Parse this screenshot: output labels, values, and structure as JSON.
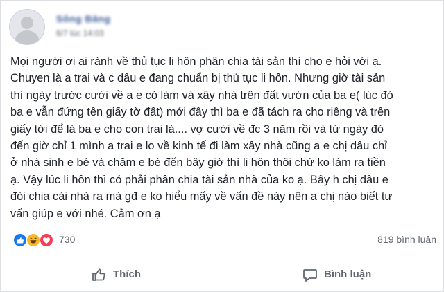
{
  "post": {
    "author_name": "Sông Băng",
    "timestamp": "6/7 lúc 14:03",
    "body_lines": [
      "Mọi người ơi ai rành về thủ tục li hôn phân chia tài sản thì cho e hỏi với ạ.",
      "Chuyen là a trai và c dâu e đang chuẩn bị thủ tục li hôn. Nhưng giờ tài sản",
      "thì ngày trước cưới về a e có làm và xây nhà trên đất vườn của ba e( lúc đó",
      "ba e vẫn đứng tên giấy tờ đất) mới đây thì ba e đã tách ra cho riêng và trên",
      "giấy tời để là ba e cho con trai là.... vợ cưới về đc 3 năm rồi và từ ngày đó",
      "đến giờ chỉ 1 mình a trai e lo về kinh tế đi làm xây nhà cũng a e chị dâu chỉ",
      "ở nhà sinh e bé và chăm e bé đến bây giờ thì li hôn thôi chứ ko làm ra tiền",
      "ạ. Vậy lúc li hôn thì có phải phân chia tài sản nhà của ko ạ. Bây h chị dâu e",
      "đòi chia cái nhà ra mà gđ e ko hiểu mấy về vấn đề này nên a chị nào biết tư",
      "vấn giúp e với nhé. Cảm ơn ạ"
    ]
  },
  "reactions": {
    "icons": [
      "like-icon",
      "haha-icon",
      "love-icon"
    ],
    "count": "730",
    "comments": "819 bình luận"
  },
  "actions": {
    "like_label": "Thích",
    "comment_label": "Bình luận"
  },
  "colors": {
    "like_blue": "#1877f2",
    "haha_yellow": "#f7b928",
    "love_red": "#f33e58",
    "name_blue": "#385898",
    "muted_text": "#606770"
  }
}
